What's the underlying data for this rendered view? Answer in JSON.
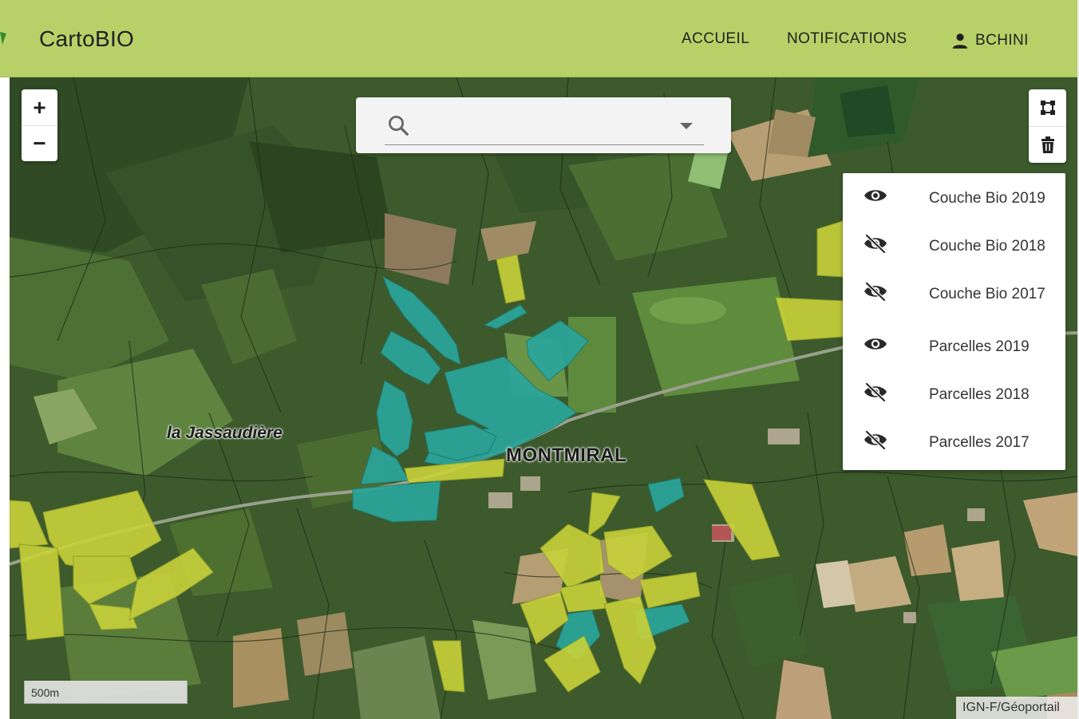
{
  "app": {
    "title": "CartoBIO",
    "brand_color": "#b7d168"
  },
  "nav": {
    "home_label": "ACCUEIL",
    "notifications_label": "NOTIFICATIONS",
    "user_label": "BCHINI",
    "user_icon": "person-icon"
  },
  "map": {
    "place_labels": [
      "la Jassaudière",
      "MONTMIRAL"
    ],
    "zoom_in_label": "+",
    "zoom_out_label": "−",
    "scale_label": "500m",
    "attribution": "IGN-F/Géoportail",
    "organic_parcel_color": "#2aa59b",
    "conversion_parcel_color": "#c8d23a"
  },
  "search": {
    "placeholder": "",
    "icon": "search-icon",
    "dropdown_icon": "arrow-drop-down-icon"
  },
  "draw_tools": {
    "polygon_icon": "draw-polygon-icon",
    "delete_icon": "trash-icon"
  },
  "layers": [
    {
      "label": "Couche Bio 2019",
      "visible": true
    },
    {
      "label": "Couche Bio 2018",
      "visible": false
    },
    {
      "label": "Couche Bio 2017",
      "visible": false
    },
    {
      "label": "Parcelles 2019",
      "visible": true
    },
    {
      "label": "Parcelles 2018",
      "visible": false
    },
    {
      "label": "Parcelles 2017",
      "visible": false
    }
  ]
}
